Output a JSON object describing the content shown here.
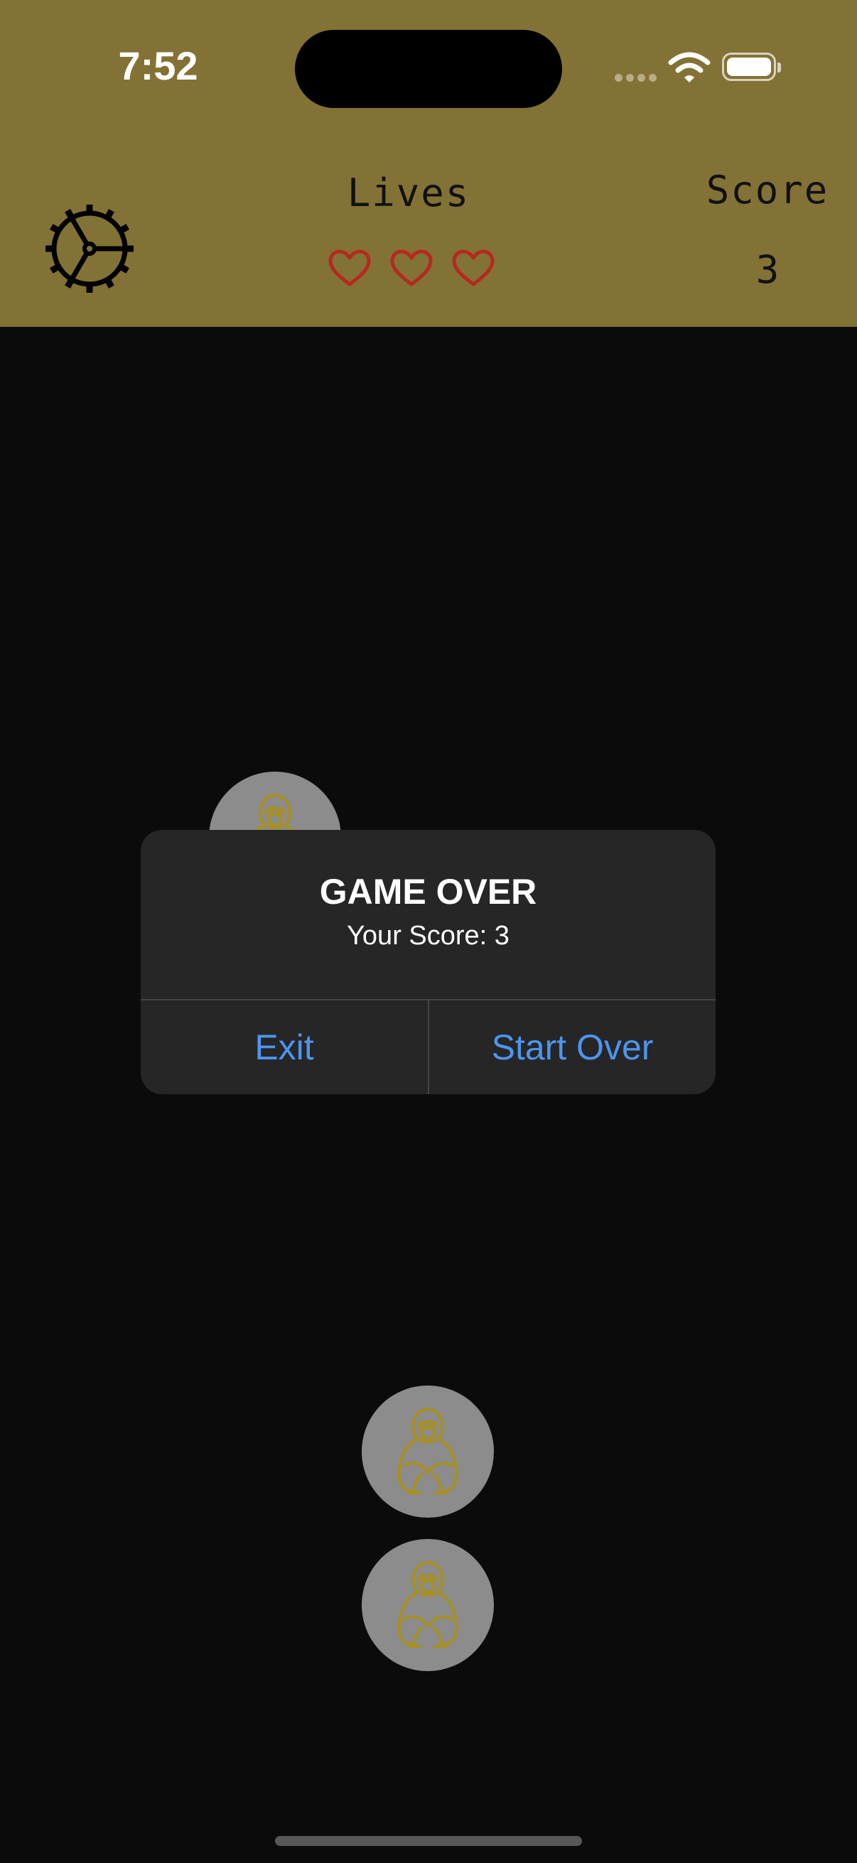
{
  "status_bar": {
    "time": "7:52",
    "icons": [
      "cellular-signal-icon",
      "wifi-icon",
      "battery-icon"
    ]
  },
  "header": {
    "settings_icon": "gear-icon",
    "lives_label": "Lives",
    "lives": 3,
    "heart_icon": "heart-outline-icon",
    "score_label": "Score",
    "score_value": "3"
  },
  "board": {
    "token_icon": "monkey-icon",
    "token_count_visible": 3
  },
  "alert": {
    "title": "GAME OVER",
    "message": "Your Score: 3",
    "buttons": [
      "Exit",
      "Start Over"
    ]
  },
  "colors": {
    "header_background": "#837235",
    "board_background": "#0b0b0b",
    "heart_stroke": "#b5291f",
    "token_background": "#8c8c8c",
    "monkey_stroke": "#a8901f",
    "alert_background": "#262626",
    "alert_button_text": "#4d95f0"
  }
}
